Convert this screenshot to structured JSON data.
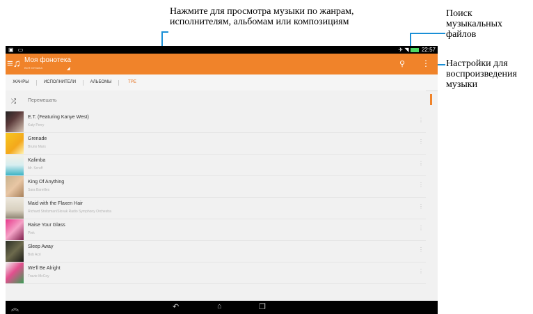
{
  "annotations": {
    "categories": "Нажмите для просмотра музыки по жанрам, исполнителям, альбомам или композициям",
    "search": "Поиск музыкальных файлов",
    "settings": "Настройки для воспроизведения музыки"
  },
  "status": {
    "time": "22:57"
  },
  "app": {
    "title": "Моя фонотека",
    "subtitle": "ВСЯ МУЗЫКА"
  },
  "tabs": [
    "ЖАНРЫ",
    "ИСПОЛНИТЕЛИ",
    "АЛЬБОМЫ",
    "ТРЕ"
  ],
  "shuffle_label": "Перемешать",
  "tracks": [
    {
      "title": "E.T. (Featuring Kanye West)",
      "artist": "Katy Perry"
    },
    {
      "title": "Grenade",
      "artist": "Bruno Mars"
    },
    {
      "title": "Kalimba",
      "artist": "Mr. Scruff"
    },
    {
      "title": "King Of Anything",
      "artist": "Sara Bareilles"
    },
    {
      "title": "Maid with the Flaxen Hair",
      "artist": "Richard Stoltzman/Slovak Radio Symphony Orchestra"
    },
    {
      "title": "Raise Your Glass",
      "artist": "Pink"
    },
    {
      "title": "Sleep Away",
      "artist": "Bob Acri"
    },
    {
      "title": "We'll Be Alright",
      "artist": "Travie McCoy"
    }
  ],
  "colors": {
    "accent": "#f0832a",
    "callout": "#1a8fd6"
  }
}
